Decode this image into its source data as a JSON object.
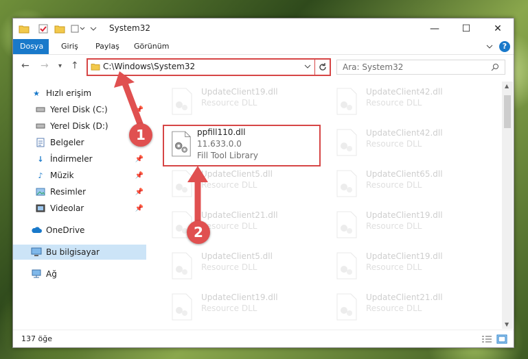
{
  "window": {
    "title": "System32",
    "controls": {
      "minimize": "—",
      "maximize": "☐",
      "close": "✕"
    }
  },
  "ribbon": {
    "tabs": [
      "Dosya",
      "Giriş",
      "Paylaş",
      "Görünüm"
    ],
    "help": "?"
  },
  "address": {
    "path": "C:\\Windows\\System32",
    "search_placeholder": "Ara: System32"
  },
  "sidebar": {
    "items": [
      {
        "label": "Hızlı erişim",
        "icon": "star-icon"
      },
      {
        "label": "Yerel Disk (C:)",
        "icon": "drive-icon"
      },
      {
        "label": "Yerel Disk (D:)",
        "icon": "drive-icon"
      },
      {
        "label": "Belgeler",
        "icon": "documents-icon"
      },
      {
        "label": "İndirmeler",
        "icon": "download-icon"
      },
      {
        "label": "Müzik",
        "icon": "music-icon"
      },
      {
        "label": "Resimler",
        "icon": "pictures-icon"
      },
      {
        "label": "Videolar",
        "icon": "videos-icon"
      },
      {
        "label": "OneDrive",
        "icon": "cloud-icon"
      },
      {
        "label": "Bu bilgisayar",
        "icon": "computer-icon"
      },
      {
        "label": "Ağ",
        "icon": "network-icon"
      }
    ]
  },
  "files": {
    "left": [
      {
        "name": "UpdateClient19.dll",
        "type": "Resource DLL"
      },
      {
        "name": "ppfill110.dll",
        "version": "11.633.0.0",
        "desc": "Fill Tool Library"
      },
      {
        "name": "UpdateClient5.dll",
        "type": "Resource DLL"
      },
      {
        "name": "UpdateClient21.dll",
        "type": "Resource DLL"
      },
      {
        "name": "UpdateClient5.dll",
        "type": "Resource DLL"
      },
      {
        "name": "UpdateClient19.dll",
        "type": "Resource DLL"
      }
    ],
    "right": [
      {
        "name": "UpdateClient42.dll",
        "type": "Resource DLL"
      },
      {
        "name": "UpdateClient42.dll",
        "type": "Resource DLL"
      },
      {
        "name": "UpdateClient65.dll",
        "type": "Resource DLL"
      },
      {
        "name": "UpdateClient19.dll",
        "type": "Resource DLL"
      },
      {
        "name": "UpdateClient19.dll",
        "type": "Resource DLL"
      },
      {
        "name": "UpdateClient21.dll",
        "type": "Resource DLL"
      }
    ]
  },
  "status": {
    "count": "137 öğe"
  },
  "annotations": {
    "one": "1",
    "two": "2"
  },
  "colors": {
    "accent": "#1979ca",
    "highlight": "#d64545",
    "selected": "#cce4f7"
  }
}
